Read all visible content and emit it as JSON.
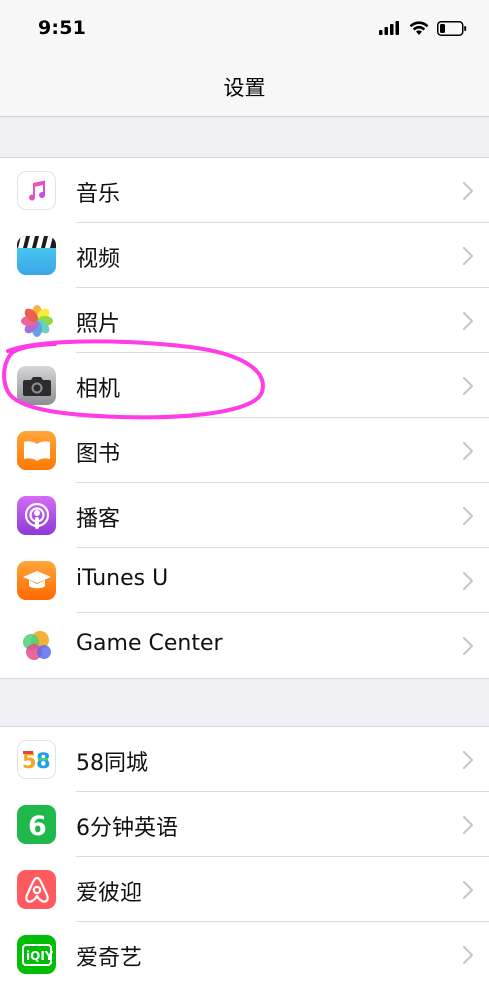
{
  "status": {
    "time": "9:51"
  },
  "nav": {
    "title": "设置"
  },
  "groups": [
    {
      "items": [
        {
          "label": "音乐",
          "icon": "music-icon"
        },
        {
          "label": "视频",
          "icon": "videos-icon"
        },
        {
          "label": "照片",
          "icon": "photos-icon"
        },
        {
          "label": "相机",
          "icon": "camera-icon"
        },
        {
          "label": "图书",
          "icon": "books-icon"
        },
        {
          "label": "播客",
          "icon": "podcasts-icon"
        },
        {
          "label": "iTunes U",
          "icon": "itunes-u-icon"
        },
        {
          "label": "Game Center",
          "icon": "game-center-icon"
        }
      ]
    },
    {
      "items": [
        {
          "label": "58同城",
          "icon": "58-icon"
        },
        {
          "label": "6分钟英语",
          "icon": "6-minute-english-icon"
        },
        {
          "label": "爱彼迎",
          "icon": "airbnb-icon"
        },
        {
          "label": "爱奇艺",
          "icon": "iqiyi-icon"
        }
      ]
    }
  ],
  "colors": {
    "background": "#efeff4",
    "annotation": "#ff3ce6",
    "chevron": "#c7c7cc"
  }
}
